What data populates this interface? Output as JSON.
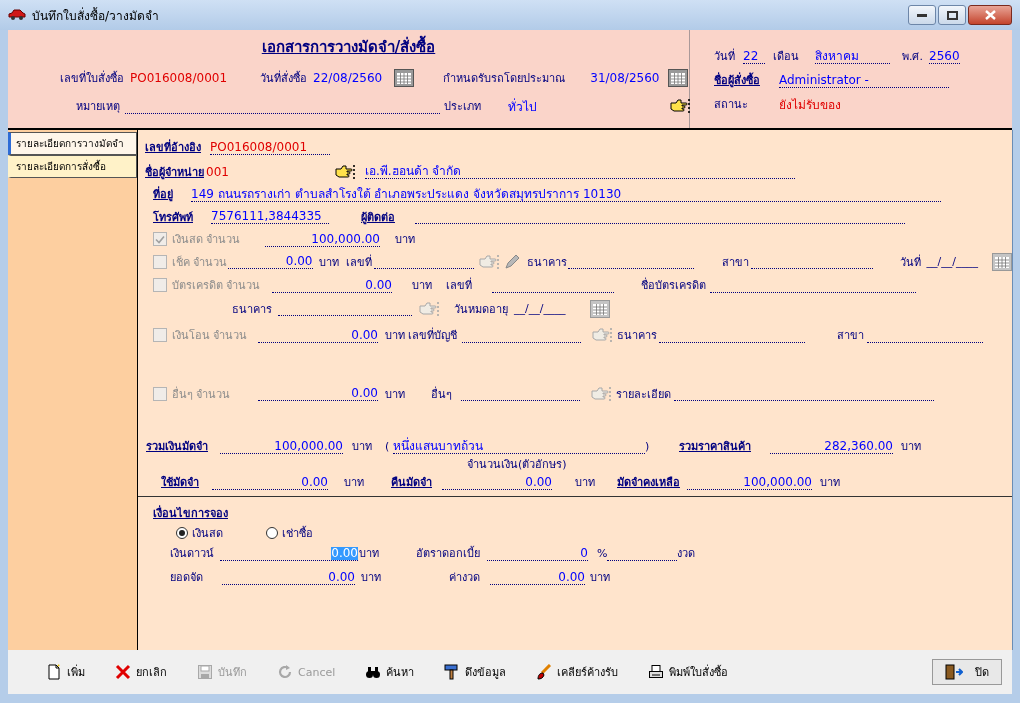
{
  "window": {
    "title": "บันทึกใบสั่งซื้อ/วางมัดจำ"
  },
  "header": {
    "title": "เอกสารการวางมัดจำ/สั่งซื้อ",
    "order_line": [
      {
        "kind": "text",
        "text": "เลขที่ใบสั่งซื้อ"
      },
      {
        "kind": "alert_value",
        "text": "PO016008/0001"
      },
      {
        "kind": "text",
        "text": "วันที่สั่งซื้อ"
      },
      {
        "kind": "value",
        "text": "22/08/2560"
      },
      {
        "kind": "date",
        "disabled": false
      },
      {
        "kind": "text",
        "text": "กำหนดรับรถโดยประมาณ"
      },
      {
        "kind": "value",
        "text": "31/08/2560"
      },
      {
        "kind": "date",
        "disabled": false
      }
    ],
    "note_line": [
      {
        "kind": "text",
        "text": "หมายเหตุ"
      },
      {
        "kind": "blank"
      },
      {
        "kind": "text",
        "text": "ประเภท"
      },
      {
        "kind": "value",
        "text": "ทั่วไป"
      },
      {
        "kind": "picker",
        "disabled": false
      }
    ],
    "side_rows": [
      [
        {
          "kind": "text",
          "text": "วันที่"
        },
        {
          "kind": "field",
          "text": "22"
        },
        {
          "kind": "text",
          "text": "เดือน"
        },
        {
          "kind": "field",
          "text": "สิงหาคม"
        },
        {
          "kind": "text",
          "text": "พ.ศ."
        },
        {
          "kind": "field",
          "text": "2560"
        }
      ],
      [
        {
          "kind": "link",
          "text": "ชื่อผู้สั่งซื้อ"
        },
        {
          "kind": "field",
          "text": "Administrator -"
        }
      ],
      [
        {
          "kind": "text",
          "text": "สถานะ"
        },
        {
          "kind": "alert_value",
          "text": "ยังไม่รับของ"
        }
      ]
    ]
  },
  "tabs": [
    {
      "label": "รายละเอียดการวางมัดจำ",
      "selected": true
    },
    {
      "label": "รายละเอียดการสั่งซื้อ",
      "selected": false
    }
  ],
  "detail_rows": [
    [
      {
        "kind": "link",
        "text": "เลขที่อ้างอิง"
      },
      {
        "kind": "alert_field",
        "text": "PO016008/0001"
      }
    ],
    [
      {
        "kind": "link",
        "text": "ชื่อผู้จำหน่าย"
      },
      {
        "kind": "alert_value",
        "text": "001"
      },
      {
        "kind": "picker",
        "disabled": false
      },
      {
        "kind": "field",
        "text": "เอ.พี.ฮอนด้า จำกัด"
      }
    ],
    [
      {
        "kind": "link",
        "text": "ที่อยู่"
      },
      {
        "kind": "field",
        "text": "149 ถนนรถรางเก่า ตำบลสำโรงใต้ อำเภอพระประแดง จังหวัดสมุทรปราการ 10130"
      }
    ],
    [
      {
        "kind": "link",
        "text": "โทรศัพท์"
      },
      {
        "kind": "field",
        "text": "7576111,3844335"
      },
      {
        "kind": "link",
        "text": "ผู้ติดต่อ"
      },
      {
        "kind": "blank"
      }
    ],
    [
      {
        "kind": "check",
        "text": "เงินสด จำนวน",
        "checked": true,
        "disabled": true
      },
      {
        "kind": "amount",
        "text": "100,000.00"
      },
      {
        "kind": "text",
        "text": "บาท"
      }
    ],
    [
      {
        "kind": "check",
        "text": "เช็ค จำนวน",
        "checked": false,
        "disabled": true
      },
      {
        "kind": "amount",
        "text": "0.00"
      },
      {
        "kind": "text",
        "text": "บาท"
      },
      {
        "kind": "text",
        "text": "เลขที่"
      },
      {
        "kind": "blank"
      },
      {
        "kind": "picker",
        "disabled": true
      },
      {
        "kind": "edit",
        "disabled": true
      },
      {
        "kind": "text",
        "text": "ธนาคาร"
      },
      {
        "kind": "blank"
      },
      {
        "kind": "text",
        "text": "สาขา"
      },
      {
        "kind": "blank"
      },
      {
        "kind": "text",
        "text": "วันที่"
      },
      {
        "kind": "text",
        "text": "__/__/____"
      },
      {
        "kind": "date",
        "disabled": true
      }
    ],
    [
      {
        "kind": "check",
        "text": "บัตรเครดิต  จำนวน",
        "checked": false,
        "disabled": true
      },
      {
        "kind": "amount",
        "text": "0.00"
      },
      {
        "kind": "text",
        "text": "บาท"
      },
      {
        "kind": "text",
        "text": "เลขที่"
      },
      {
        "kind": "blank"
      },
      {
        "kind": "text",
        "text": "ชื่อบัตรเครดิต"
      },
      {
        "kind": "blank"
      }
    ],
    [
      {
        "kind": "text",
        "text": "ธนาคาร"
      },
      {
        "kind": "blank"
      },
      {
        "kind": "picker",
        "disabled": true
      },
      {
        "kind": "text",
        "text": "วันหมดอายุ"
      },
      {
        "kind": "text",
        "text": "__/__/____"
      },
      {
        "kind": "date",
        "disabled": true
      }
    ],
    [
      {
        "kind": "check",
        "text": "เงินโอน จำนวน",
        "checked": false,
        "disabled": true
      },
      {
        "kind": "amount",
        "text": "0.00"
      },
      {
        "kind": "text",
        "text": "บาท เลขที่บัญชี"
      },
      {
        "kind": "blank"
      },
      {
        "kind": "picker",
        "disabled": true
      },
      {
        "kind": "text",
        "text": "ธนาคาร"
      },
      {
        "kind": "blank"
      },
      {
        "kind": "text",
        "text": "สาขา"
      },
      {
        "kind": "blank"
      }
    ],
    [
      {
        "kind": "check",
        "text": "อื่นๆ จำนวน",
        "checked": false,
        "disabled": true
      },
      {
        "kind": "amount",
        "text": "0.00"
      },
      {
        "kind": "text",
        "text": "บาท"
      },
      {
        "kind": "text",
        "text": "อื่นๆ"
      },
      {
        "kind": "blank"
      },
      {
        "kind": "picker",
        "disabled": true
      },
      {
        "kind": "text",
        "text": "รายละเอียด"
      },
      {
        "kind": "blank"
      }
    ],
    [
      {
        "kind": "link",
        "text": "รวมเงินมัดจำ"
      },
      {
        "kind": "amount",
        "text": "100,000.00"
      },
      {
        "kind": "text",
        "text": "บาท"
      },
      {
        "kind": "text",
        "text": "("
      },
      {
        "kind": "field",
        "text": "หนึ่งแสนบาทถ้วน"
      },
      {
        "kind": "text",
        "text": ")"
      },
      {
        "kind": "link",
        "text": "รวมราคาสินค้า"
      },
      {
        "kind": "amount",
        "text": "282,360.00"
      },
      {
        "kind": "text",
        "text": "บาท"
      }
    ],
    [
      {
        "kind": "text",
        "text": "จำนวนเงิน(ตัวอักษร)"
      }
    ],
    [
      {
        "kind": "link",
        "text": "ใช้มัดจำ"
      },
      {
        "kind": "amount",
        "text": "0.00"
      },
      {
        "kind": "text",
        "text": "บาท"
      },
      {
        "kind": "link",
        "text": "คืนมัดจำ"
      },
      {
        "kind": "amount",
        "text": "0.00"
      },
      {
        "kind": "text",
        "text": "บาท"
      },
      {
        "kind": "link",
        "text": "มัดจำคงเหลือ"
      },
      {
        "kind": "amount",
        "text": "100,000.00"
      },
      {
        "kind": "text",
        "text": "บาท"
      }
    ]
  ],
  "booking": {
    "title": "เงื่อนไขการจอง",
    "options": [
      {
        "label": "เงินสด",
        "selected": true
      },
      {
        "label": "เช่าซื้อ",
        "selected": false
      }
    ],
    "rows": [
      [
        {
          "kind": "text",
          "text": "เงินดาวน์"
        },
        {
          "kind": "selected_amount",
          "text": "0.00"
        },
        {
          "kind": "text",
          "text": "บาท"
        },
        {
          "kind": "text",
          "text": "อัตราดอกเบี้ย"
        },
        {
          "kind": "amount",
          "text": "0"
        },
        {
          "kind": "text",
          "text": "%"
        },
        {
          "kind": "blank"
        },
        {
          "kind": "text",
          "text": "งวด"
        }
      ],
      [
        {
          "kind": "text",
          "text": "ยอดจัด"
        },
        {
          "kind": "amount",
          "text": "0.00"
        },
        {
          "kind": "text",
          "text": "บาท"
        },
        {
          "kind": "text",
          "text": "ค่างวด"
        },
        {
          "kind": "amount",
          "text": "0.00"
        },
        {
          "kind": "text",
          "text": "บาท"
        }
      ]
    ]
  },
  "toolbar": [
    {
      "kind": "add",
      "label": "เพิ่ม",
      "disabled": false
    },
    {
      "kind": "cancel",
      "label": "ยกเลิก",
      "disabled": false
    },
    {
      "kind": "save",
      "label": "บันทึก",
      "disabled": true
    },
    {
      "kind": "undo",
      "label": "Cancel",
      "disabled": true
    },
    {
      "kind": "search",
      "label": "ค้นหา",
      "disabled": false
    },
    {
      "kind": "fetch",
      "label": "ดึงข้อมูล",
      "disabled": false
    },
    {
      "kind": "clear",
      "label": "เคลียร์ค้างรับ",
      "disabled": false
    },
    {
      "kind": "print",
      "label": "พิมพ์ใบสั่งซื้อ",
      "disabled": false
    }
  ],
  "close_button": {
    "label": "ปิด"
  }
}
